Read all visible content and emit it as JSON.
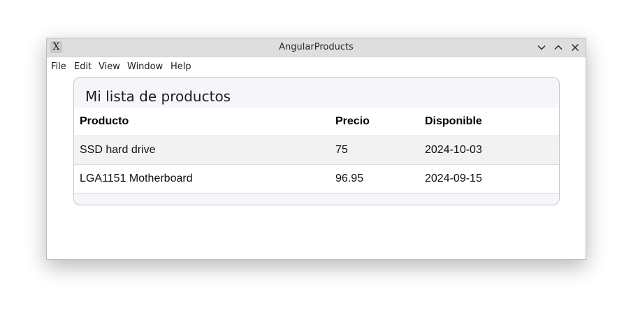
{
  "window": {
    "title": "AngularProducts",
    "app_icon_glyph": "X",
    "controls": [
      "minimize-icon",
      "maximize-icon",
      "close-icon"
    ]
  },
  "menubar": {
    "items": [
      "File",
      "Edit",
      "View",
      "Window",
      "Help"
    ]
  },
  "card": {
    "title": "Mi lista de productos"
  },
  "table": {
    "headers": [
      "Producto",
      "Precio",
      "Disponible"
    ],
    "rows": [
      [
        "SSD hard drive",
        "75",
        "2024-10-03"
      ],
      [
        "LGA1151 Motherboard",
        "96.95",
        "2024-09-15"
      ]
    ]
  },
  "colors": {
    "titlebar": "#dedede",
    "card_background": "#f6f6fa",
    "odd_row": "#f2f2f2"
  }
}
